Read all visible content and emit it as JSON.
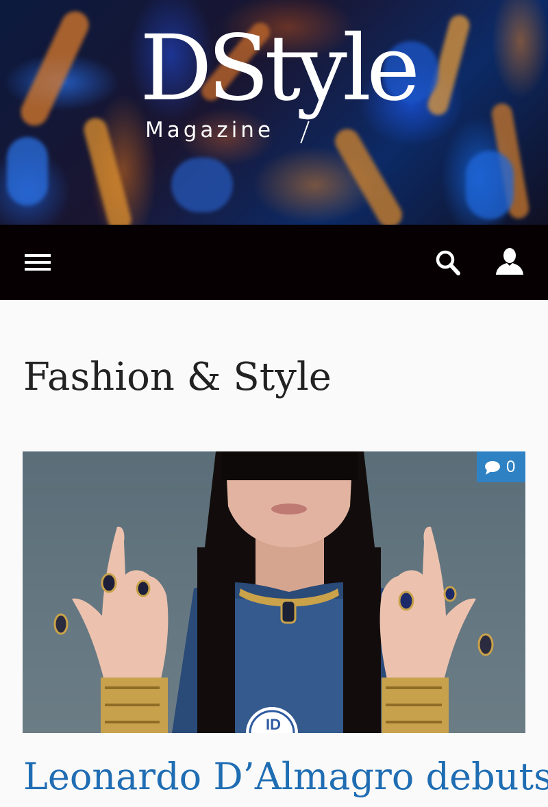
{
  "brand": {
    "name": "DStyle",
    "tagline": "Magazine"
  },
  "nav": {
    "menu_icon": "hamburger-menu-icon",
    "search_icon": "search-icon",
    "user_icon": "user-icon"
  },
  "category": {
    "title": "Fashion & Style"
  },
  "article": {
    "title": "Leonardo D’Almagro debuts",
    "comment_count": "0",
    "comment_icon": "comment-bubble-icon",
    "image_caption_mark": "ID"
  },
  "colors": {
    "navbar": "#060002",
    "accent": "#2e82c4",
    "link": "#1f6db3",
    "heading": "#222222",
    "background": "#fafafa"
  }
}
